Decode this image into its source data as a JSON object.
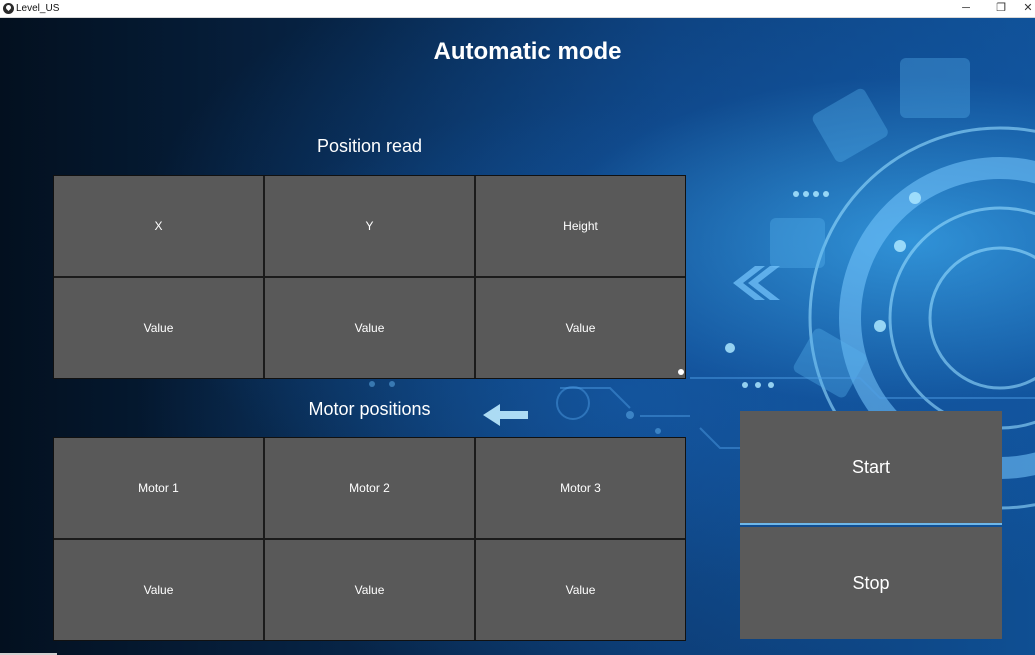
{
  "window": {
    "title": "Level_US",
    "minimize_glyph": "─",
    "restore_glyph": "❐",
    "close_glyph": "✕"
  },
  "page": {
    "title": "Automatic mode"
  },
  "position_read": {
    "title": "Position read",
    "headers": [
      "X",
      "Y",
      "Height"
    ],
    "values": [
      "Value",
      "Value",
      "Value"
    ]
  },
  "motor_positions": {
    "title": "Motor positions",
    "headers": [
      "Motor 1",
      "Motor 2",
      "Motor 3"
    ],
    "values": [
      "Value",
      "Value",
      "Value"
    ]
  },
  "controls": {
    "start_label": "Start",
    "stop_label": "Stop"
  },
  "colors": {
    "cell_bg": "#595959",
    "button_bg": "#5a5a5a",
    "accent": "#6fb7e8"
  },
  "icons": {
    "app": "app-logo-icon",
    "background": "gear-circuit-background"
  }
}
